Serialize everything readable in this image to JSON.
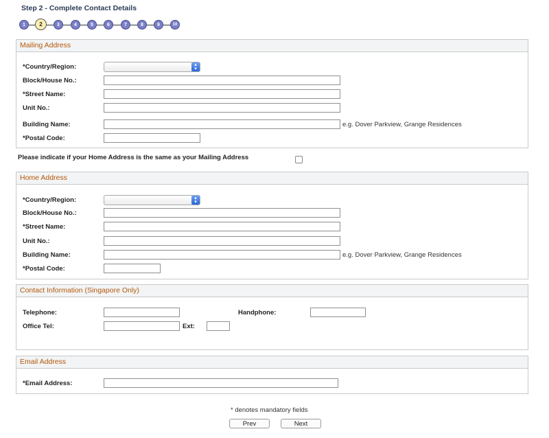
{
  "step": {
    "title": "Step 2 - Complete Contact Details",
    "numbers": [
      "1",
      "2",
      "3",
      "4",
      "5",
      "6",
      "7",
      "8",
      "9",
      "10"
    ],
    "current": "2"
  },
  "mailing": {
    "header": "Mailing Address",
    "country_label": "*Country/Region:",
    "block_label": "Block/House No.:",
    "street_label": "*Street Name:",
    "unit_label": "Unit No.:",
    "building_label": "Building Name:",
    "building_hint": "e.g. Dover Parkview, Grange Residences",
    "postal_label": "*Postal Code:"
  },
  "same_address_question": "Please indicate if your Home Address is the same as your Mailing Address",
  "home": {
    "header": "Home Address",
    "country_label": "*Country/Region:",
    "block_label": "Block/House No.:",
    "street_label": "*Street Name:",
    "unit_label": "Unit No.:",
    "building_label": "Building Name:",
    "building_hint": "e.g. Dover Parkview, Grange Residences",
    "postal_label": "*Postal Code:"
  },
  "contact": {
    "header": "Contact Information (Singapore Only)",
    "telephone_label": "Telephone:",
    "handphone_label": "Handphone:",
    "office_label": "Office Tel:",
    "ext_label": "Ext:"
  },
  "email": {
    "header": "Email Address",
    "email_label": "*Email Address:"
  },
  "footer": {
    "mandatory_note": "* denotes mandatory fields",
    "prev_label": "Prev",
    "next_label": "Next"
  },
  "icons": {
    "select_arrow": "select-arrows-icon"
  }
}
